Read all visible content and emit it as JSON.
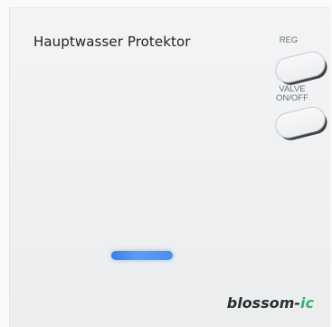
{
  "device": {
    "title": "Hauptwasser Protektor",
    "brand_main": "blossom-",
    "brand_accent": "ic",
    "brand_accent_color": "#2bb673",
    "led_color": "#4b8ee9"
  },
  "buttons": {
    "reg_label": "REG",
    "valve_label_line1": "VALVE",
    "valve_label_line2": "ON/OFF"
  }
}
